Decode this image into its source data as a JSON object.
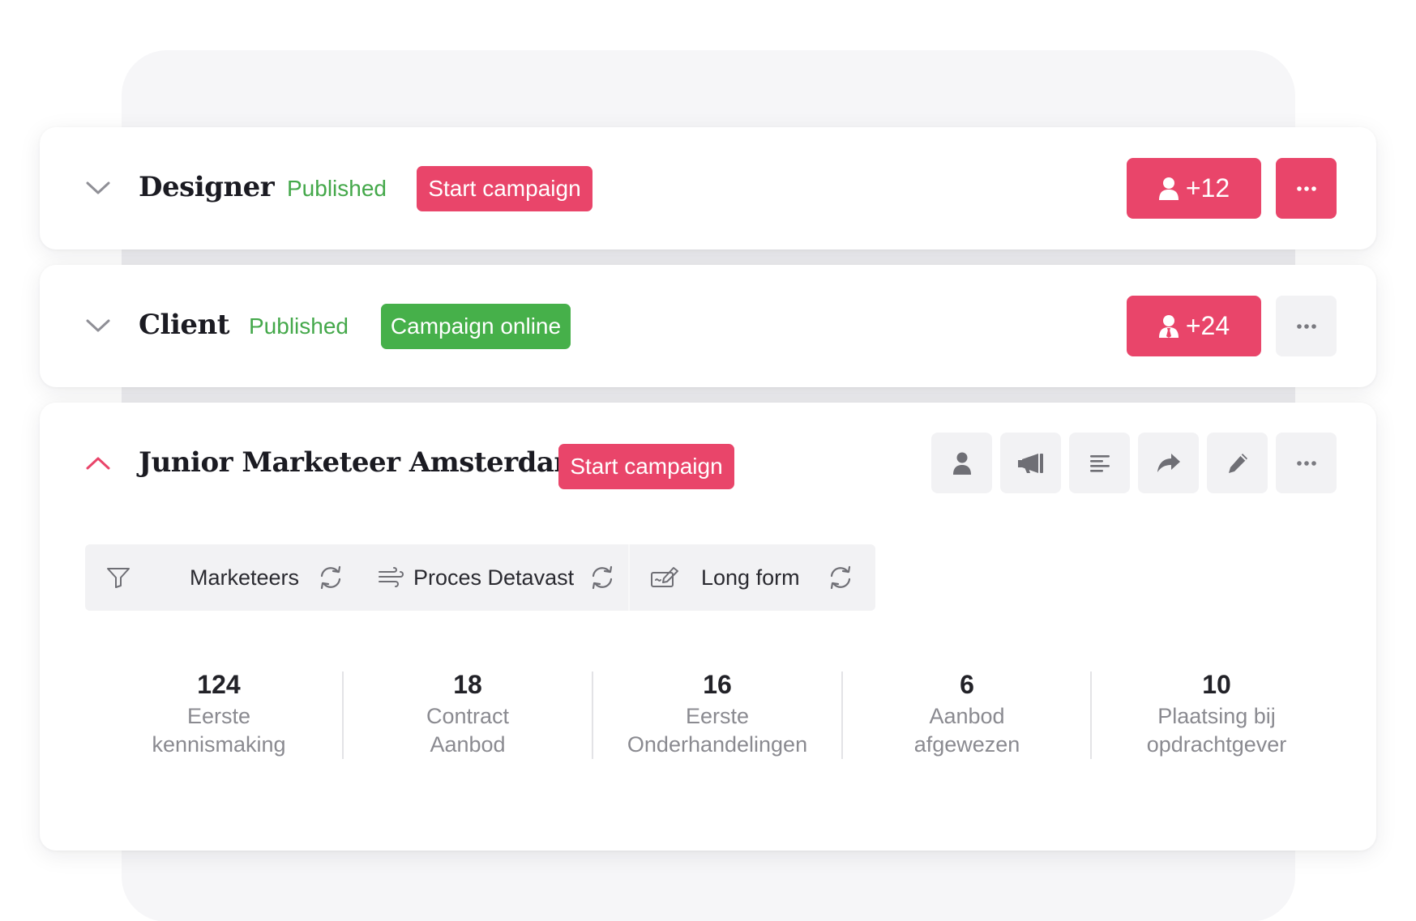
{
  "colors": {
    "accent_red": "#e9456a",
    "success_green": "#46b04a",
    "status_text_green": "#44a84a",
    "neutral_button": "#f2f2f4"
  },
  "vacancies": [
    {
      "title": "Designer",
      "status": "Published",
      "campaign_button": "Start campaign",
      "candidates_count": "+12",
      "candidate_icon": "person-icon",
      "more_icon": "more-horizontal-icon",
      "expanded": false
    },
    {
      "title": "Client",
      "status": "Published",
      "campaign_button": "Campaign online",
      "candidates_count": "+24",
      "candidate_icon": "person-tie-icon",
      "more_icon": "more-horizontal-icon",
      "expanded": false
    },
    {
      "title": "Junior Marketeer Amsterdam",
      "campaign_button": "Start campaign",
      "expanded": true,
      "toolbar_icons": [
        "person-icon",
        "megaphone-icon",
        "text-align-icon",
        "share-arrow-icon",
        "pencil-icon",
        "more-horizontal-icon"
      ],
      "filters": [
        {
          "label": "Marketeers",
          "icon": "filter-icon",
          "action_icon": "refresh-icon"
        },
        {
          "label": "Proces Detavast",
          "icon": "wind-icon",
          "action_icon": "refresh-icon"
        },
        {
          "label": "Long form",
          "icon": "form-edit-icon",
          "action_icon": "refresh-icon"
        }
      ],
      "stats": [
        {
          "value": "124",
          "label_line1": "Eerste",
          "label_line2": "kennismaking"
        },
        {
          "value": "18",
          "label_line1": "Contract",
          "label_line2": "Aanbod"
        },
        {
          "value": "16",
          "label_line1": "Eerste",
          "label_line2": "Onderhandelingen"
        },
        {
          "value": "6",
          "label_line1": "Aanbod",
          "label_line2": "afgewezen"
        },
        {
          "value": "10",
          "label_line1": "Plaatsing bij",
          "label_line2": "opdrachtgever"
        }
      ]
    }
  ]
}
